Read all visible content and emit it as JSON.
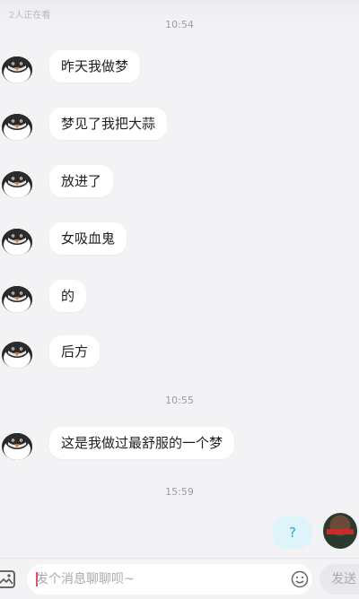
{
  "top_hint": "2人正在看",
  "timestamps": [
    "10:54",
    "10:55",
    "15:59"
  ],
  "messages": [
    {
      "text": "昨天我做梦"
    },
    {
      "text": "梦见了我把大蒜"
    },
    {
      "text": "放进了"
    },
    {
      "text": "女吸血鬼"
    },
    {
      "text": "的"
    },
    {
      "text": "后方"
    },
    {
      "text": "这是我做过最舒服的一个梦"
    }
  ],
  "my_message": {
    "text": "?"
  },
  "input": {
    "placeholder": "发个消息聊聊呗~",
    "value": "",
    "send_label": "发送",
    "image_icon": "image-icon",
    "emoji_icon": "emoji-icon"
  },
  "colors": {
    "background": "#f3f3f5",
    "bubble": "#ffffff",
    "my_bubble": "#dff3fb",
    "my_bubble_text": "#2aa6d6",
    "timestamp": "#9a9aa0"
  }
}
